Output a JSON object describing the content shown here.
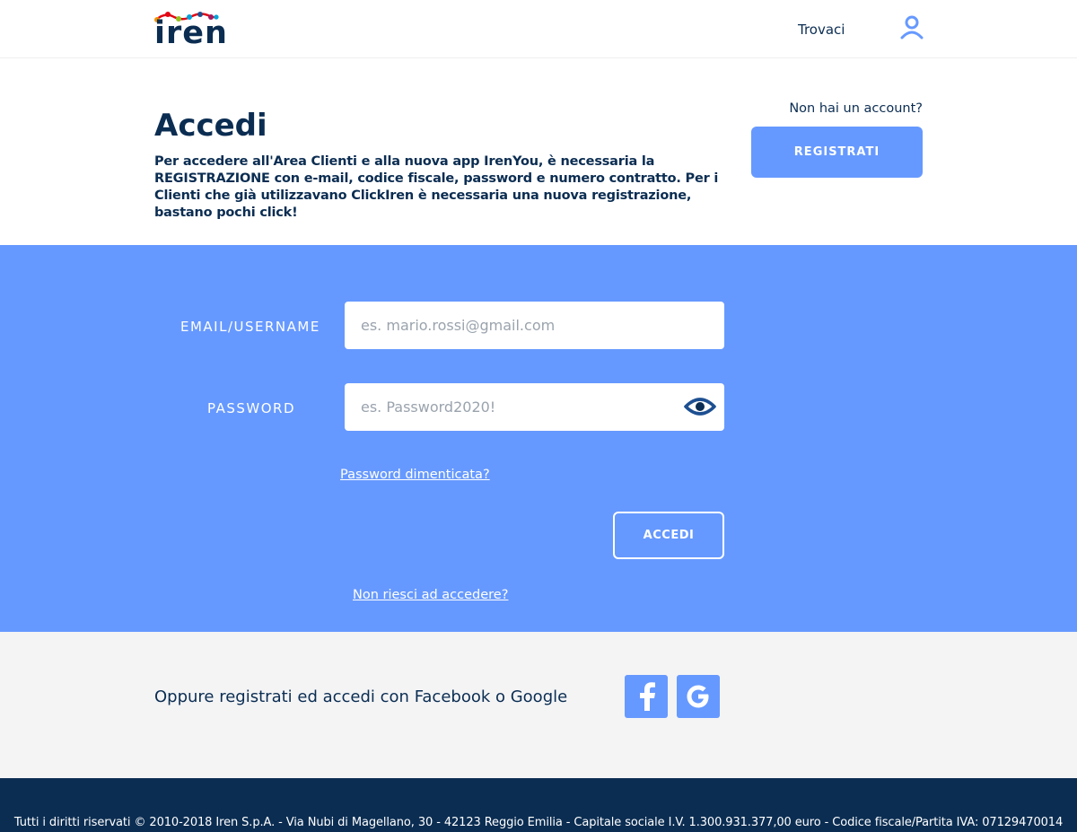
{
  "header": {
    "logo_text": "iren",
    "logo_colors": [
      "#f29100",
      "#e30613",
      "#95c11f",
      "#00a3d9",
      "#1d4f91",
      "#a21a5f"
    ],
    "nav_link": "Trovaci",
    "user_icon": "user-icon"
  },
  "intro": {
    "title": "Accedi",
    "description": "Per accedere all'Area Clienti e alla nuova app IrenYou, è necessaria la REGISTRAZIONE con e-mail, codice fiscale, password e numero contratto. Per i Clienti che già utilizzavano ClickIren è necessaria una nuova registrazione, bastano pochi click!",
    "no_account": "Non hai un account?",
    "register_label": "REGISTRATI"
  },
  "login": {
    "email_label": "EMAIL/USERNAME",
    "email_placeholder": "es. mario.rossi@gmail.com",
    "email_value": "",
    "password_label": "PASSWORD",
    "password_placeholder": "es. Password2020!",
    "password_value": "",
    "show_password_icon": "eye-icon",
    "forgot_link": "Password dimenticata?",
    "submit_label": "ACCEDI",
    "trouble_link": "Non riesci ad accedere?"
  },
  "social": {
    "text": "Oppure registrati ed accedi con Facebook o Google",
    "buttons": [
      {
        "name": "facebook",
        "icon": "facebook-icon"
      },
      {
        "name": "google",
        "icon": "google-icon"
      }
    ]
  },
  "footer": {
    "text": "Tutti i diritti riservati © 2010-2018 Iren S.p.A. - Via Nubi di Magellano, 30 - 42123 Reggio Emilia - Capitale sociale I.V. 1.300.931.377,00 euro - Codice fiscale/Partita IVA: 07129470014"
  },
  "colors": {
    "brand_navy": "#0b2d52",
    "accent_blue": "#6699ff",
    "social_bg": "#f4f4f5"
  }
}
